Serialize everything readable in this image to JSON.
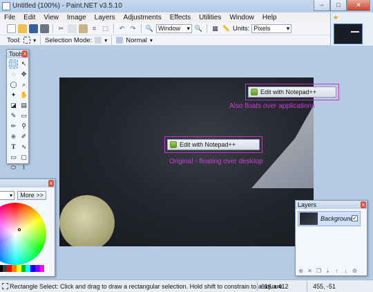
{
  "window": {
    "title": "Untitled (100%) - Paint.NET v3.5.10",
    "minimize": "–",
    "maximize": "□",
    "close": "✕"
  },
  "menu": [
    "File",
    "Edit",
    "View",
    "Image",
    "Layers",
    "Adjustments",
    "Effects",
    "Utilities",
    "Window",
    "Help"
  ],
  "toolbar": {
    "zoom_value": "Window",
    "units_label": "Units:",
    "units_value": "Pixels"
  },
  "toolbar2": {
    "tool_label": "Tool:",
    "selection_mode_label": "Selection Mode:",
    "blend_value": "Normal"
  },
  "tools_palette": {
    "title": "Tools",
    "close": "x"
  },
  "colors_palette": {
    "more_label": "More >>",
    "close": "x",
    "swatches": [
      "#000000",
      "#404040",
      "#ff0000",
      "#ff8000",
      "#ffff00",
      "#00c000",
      "#00ffff",
      "#0000ff",
      "#8000ff",
      "#ff00ff",
      "#ffffff"
    ]
  },
  "layers_palette": {
    "title": "Layers",
    "close": "x",
    "layer_name": "Background",
    "check": "✓"
  },
  "canvas": {
    "menu_float": {
      "label": "Edit with Notepad++",
      "caption": "Also floats over applications"
    },
    "menu_original": {
      "label": "Edit with Notepad++",
      "caption": "Original - floating over desktop"
    }
  },
  "status": {
    "text": "Rectangle Select: Click and drag to draw a rectangular selection. Hold shift to constrain to a square.",
    "size": "616 x 412",
    "coords": "455, -51"
  },
  "colors": {
    "accent": "#c632cf",
    "selection": "#4a88d9"
  }
}
